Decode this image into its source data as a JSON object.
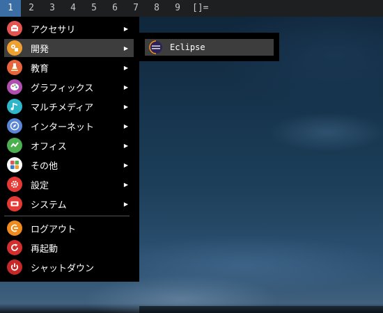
{
  "topbar": {
    "workspaces": [
      "1",
      "2",
      "3",
      "4",
      "5",
      "6",
      "7",
      "8",
      "9"
    ],
    "active_workspace": "1",
    "layout_symbol": "[]="
  },
  "menu": {
    "items": [
      {
        "label": "アクセサリ",
        "icon": "accessories-icon",
        "color": "#e5554f"
      },
      {
        "label": "開発",
        "icon": "development-icon",
        "color": "#f0a030"
      },
      {
        "label": "教育",
        "icon": "education-icon",
        "color": "#e8643c"
      },
      {
        "label": "グラフィックス",
        "icon": "graphics-icon",
        "color": "#b04fb0"
      },
      {
        "label": "マルチメディア",
        "icon": "multimedia-icon",
        "color": "#2fb6c8"
      },
      {
        "label": "インターネット",
        "icon": "internet-icon",
        "color": "#5b86d6"
      },
      {
        "label": "オフィス",
        "icon": "office-icon",
        "color": "#4caf50"
      },
      {
        "label": "その他",
        "icon": "other-icon",
        "color": "#f4f4f4"
      },
      {
        "label": "設定",
        "icon": "settings-icon",
        "color": "#e53935"
      },
      {
        "label": "システム",
        "icon": "system-icon",
        "color": "#e53935"
      }
    ],
    "session": [
      {
        "label": "ログアウト",
        "icon": "logout-icon",
        "color": "#f08a1c"
      },
      {
        "label": "再起動",
        "icon": "restart-icon",
        "color": "#d32f2f"
      },
      {
        "label": "シャットダウン",
        "icon": "shutdown-icon",
        "color": "#c62828"
      }
    ],
    "selected_index": 1,
    "submenu_arrow": "▶"
  },
  "submenu": {
    "items": [
      {
        "label": "Eclipse",
        "icon": "eclipse-icon"
      }
    ]
  },
  "colors": {
    "menu_bg": "#000000",
    "highlight": "#3d3d3d",
    "active_workspace": "#3a6ea5"
  }
}
